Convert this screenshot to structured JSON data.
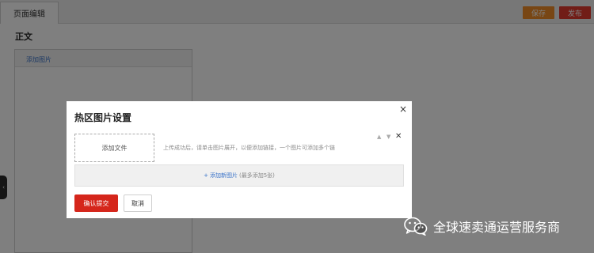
{
  "topbar": {
    "tab_label": "页面编辑",
    "save_label": "保存",
    "publish_label": "发布"
  },
  "main": {
    "section_title": "正文",
    "panel_header": "添加图片",
    "side_handle_glyph": "‹"
  },
  "modal": {
    "title": "热区图片设置",
    "close_glyph": "×",
    "upload_label": "添加文件",
    "upload_hint": "上传成功后，请单击图片展开，以便添加链接，一个图片可添加多个链",
    "move_up_glyph": "▲",
    "move_down_glyph": "▼",
    "delete_glyph": "✕",
    "add_plus": "+",
    "add_link": "添加新图片",
    "add_note": "(最多添加5张)",
    "confirm_label": "确认提交",
    "cancel_label": "取消"
  },
  "watermark": {
    "text": "全球速卖通运营服务商",
    "icon": "wechat-icon"
  },
  "colors": {
    "save": "#f08c28",
    "publish": "#e23a2e",
    "confirm": "#d5261b",
    "link": "#3a73c9"
  }
}
